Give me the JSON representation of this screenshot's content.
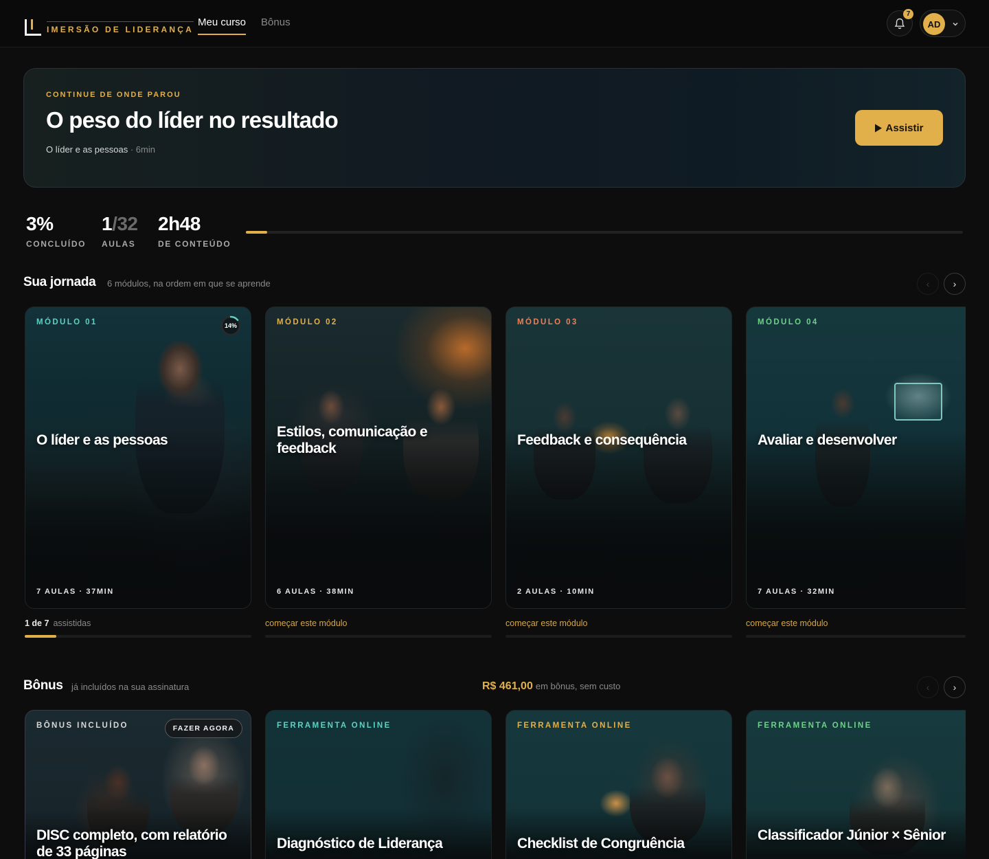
{
  "header": {
    "brand": "IMERSÃO DE LIDERANÇA",
    "nav": [
      {
        "label": "Meu curso",
        "active": true
      },
      {
        "label": "Bônus",
        "active": false
      }
    ],
    "notifications_count": "7",
    "user_initials": "AD"
  },
  "hero": {
    "eyebrow": "CONTINUE DE ONDE PAROU",
    "title": "O peso do líder no resultado",
    "module": "O líder e as pessoas",
    "duration": "· 6min",
    "button_label": "Assistir"
  },
  "stats": {
    "completed": {
      "value": "3%",
      "label": "CONCLUÍDO"
    },
    "lessons": {
      "value_done": "1",
      "value_total": "/32",
      "label": "AULAS"
    },
    "content": {
      "value": "2h48",
      "label": "DE CONTEÚDO"
    },
    "progress_fraction": 0.03
  },
  "journey": {
    "title": "Sua jornada",
    "subtitle": "6 módulos, na ordem em que se aprende",
    "modules": [
      {
        "eyebrow": "MÓDULO 01",
        "eyebrow_color": "#5fd0c2",
        "title": "O líder e as pessoas",
        "meta": "7 AULAS · 37MIN",
        "progress_label": "14%",
        "progress_fraction": 0.14,
        "under_bold": "1 de 7",
        "under_muted": "assistidas",
        "lesson_fraction": 0.14
      },
      {
        "eyebrow": "MÓDULO 02",
        "eyebrow_color": "#e2b04a",
        "title": "Estilos, comunicação e feedback",
        "meta": "6 AULAS · 38MIN",
        "under_link": "começar este módulo"
      },
      {
        "eyebrow": "MÓDULO 03",
        "eyebrow_color": "#e8805a",
        "title": "Feedback e consequência",
        "meta": "2 AULAS · 10MIN",
        "under_link": "começar este módulo"
      },
      {
        "eyebrow": "MÓDULO 04",
        "eyebrow_color": "#6fd08a",
        "title": "Avaliar e desenvolver",
        "meta": "7 AULAS · 32MIN",
        "under_link": "começar este módulo"
      }
    ]
  },
  "bonus": {
    "title": "Bônus",
    "subtitle": "já incluídos na sua assinatura",
    "value": "R$ 461,00",
    "value_note": "em bônus, sem custo",
    "items": [
      {
        "eyebrow": "BÔNUS INCLUÍDO",
        "eyebrow_color": "#d8d8d8",
        "title": "DISC completo, com relatório de 33 páginas",
        "badge": "FAZER AGORA"
      },
      {
        "eyebrow": "FERRAMENTA ONLINE",
        "eyebrow_color": "#5fd0c2",
        "title": "Diagnóstico de Liderança"
      },
      {
        "eyebrow": "FERRAMENTA ONLINE",
        "eyebrow_color": "#e2b04a",
        "title": "Checklist de Congruência"
      },
      {
        "eyebrow": "FERRAMENTA ONLINE",
        "eyebrow_color": "#6fd08a",
        "title": "Classificador Júnior × Sênior"
      }
    ]
  },
  "icons": {
    "bell": "bell-icon",
    "chevron": "chevron-down-icon",
    "play": "play-icon",
    "prev": "chevron-left-icon",
    "next": "chevron-right-icon"
  },
  "colors": {
    "accent": "#e2b04a",
    "background": "#0d0d0d"
  }
}
